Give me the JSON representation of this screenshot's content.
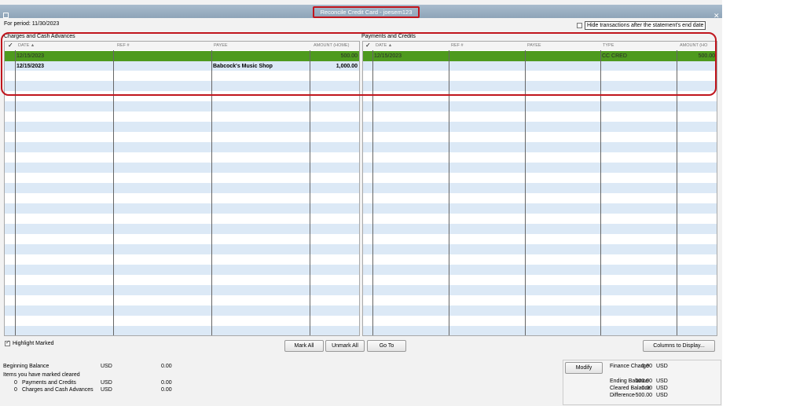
{
  "window": {
    "title": "Reconcile Credit Card - joesem123"
  },
  "period_label": "For period: 11/30/2023",
  "hide_checkbox": {
    "label": "Hide transactions after the statement's end date",
    "checked": false
  },
  "charges": {
    "section_label": "Charges and Cash Advances",
    "columns": {
      "check": "✓",
      "date": "DATE ▲",
      "ref": "REF #",
      "payee": "PAYEE",
      "amount": "AMOUNT (HOME)"
    },
    "rows": [
      {
        "marked": true,
        "date": "12/15/2023",
        "ref": "",
        "payee": "",
        "amount": "500.00"
      },
      {
        "marked": false,
        "date": "12/15/2023",
        "ref": "",
        "payee": "Babcock's Music Shop",
        "amount": "1,000.00"
      }
    ]
  },
  "payments": {
    "section_label": "Payments and Credits",
    "columns": {
      "check": "✓",
      "date": "DATE ▲",
      "ref": "REF #",
      "payee": "PAYEE",
      "type": "TYPE",
      "amount": "AMOUNT (HO"
    },
    "rows": [
      {
        "marked": true,
        "date": "12/15/2023",
        "ref": "",
        "payee": "",
        "type": "CC CRED",
        "amount": "500.00"
      }
    ]
  },
  "highlight_marked": {
    "label": "Highlight Marked",
    "checked": true
  },
  "buttons": {
    "mark_all": "Mark All",
    "unmark_all": "Unmark All",
    "go_to": "Go To",
    "columns_to_display": "Columns to Display...",
    "modify": "Modify"
  },
  "summary_left": {
    "beginning_balance": {
      "label": "Beginning Balance",
      "currency": "USD",
      "value": "0.00"
    },
    "items_marked_label": "Items you have marked cleared",
    "payments": {
      "count": "0",
      "label": "Payments and Credits",
      "currency": "USD",
      "value": "0.00"
    },
    "charges": {
      "count": "0",
      "label": "Charges and Cash Advances",
      "currency": "USD",
      "value": "0.00"
    }
  },
  "summary_right": {
    "finance_charge": {
      "label": "Finance Charge",
      "currency": "USD",
      "value": "0.00"
    },
    "ending_balance": {
      "label": "Ending Balance",
      "currency": "USD",
      "value": "500.00"
    },
    "cleared_balance": {
      "label": "Cleared Balance",
      "currency": "USD",
      "value": "0.00"
    },
    "difference": {
      "label": "Difference",
      "currency": "USD",
      "value": "-500.00"
    }
  },
  "colors": {
    "marked_row": "#4e9a1e",
    "alt_row": "#dce9f6",
    "highlight_outline": "#c0151d"
  }
}
